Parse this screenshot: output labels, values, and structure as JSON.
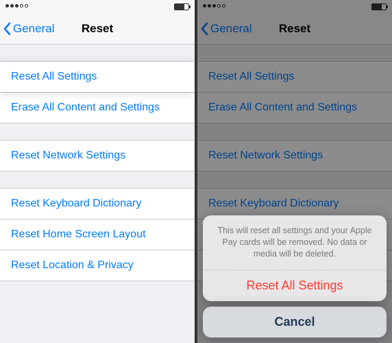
{
  "nav": {
    "back": "General",
    "title": "Reset"
  },
  "rows": {
    "reset_all": "Reset All Settings",
    "erase_all": "Erase All Content and Settings",
    "reset_network": "Reset Network Settings",
    "reset_keyboard": "Reset Keyboard Dictionary",
    "reset_home": "Reset Home Screen Layout",
    "reset_location": "Reset Location & Privacy"
  },
  "sheet": {
    "message": "This will reset all settings and your Apple Pay cards will be removed. No data or media will be deleted.",
    "confirm": "Reset All Settings",
    "cancel": "Cancel"
  }
}
